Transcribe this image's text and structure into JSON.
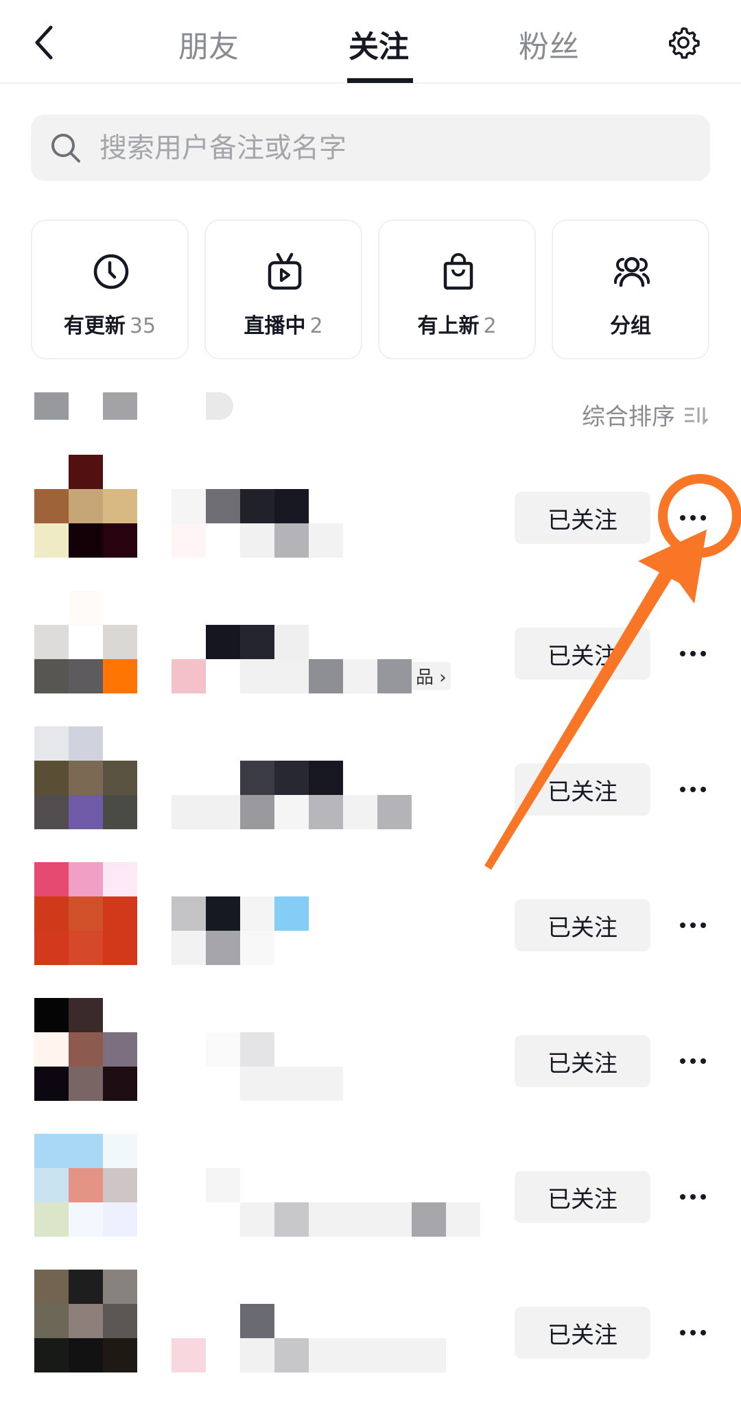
{
  "header": {
    "tabs": [
      {
        "label": "朋友"
      },
      {
        "label": "关注",
        "active": true
      },
      {
        "label": "粉丝"
      }
    ],
    "back_icon": "chevron-left-icon",
    "settings_icon": "gear-icon"
  },
  "search": {
    "placeholder": "搜索用户备注或名字",
    "value": ""
  },
  "quick_filters": [
    {
      "label": "有更新",
      "count": "35",
      "icon": "clock-icon"
    },
    {
      "label": "直播中",
      "count": "2",
      "icon": "tv-play-icon"
    },
    {
      "label": "有上新",
      "count": "2",
      "icon": "shopping-bag-icon"
    },
    {
      "label": "分组",
      "count": "",
      "icon": "group-icon"
    }
  ],
  "sort": {
    "label": "综合排序",
    "icon": "sort-icon"
  },
  "follow_label": "已关注",
  "rows": [
    {
      "avatar": [
        [
          null,
          "#521010",
          null
        ],
        [
          "#9E6339",
          "#C6A677",
          "#D8B983"
        ],
        [
          "#EFEBC4",
          "#130006",
          "#27020F"
        ]
      ],
      "name": [
        [
          "#F5F5F5",
          "#6E6E74",
          "#20212A",
          "#161720"
        ],
        [
          "#FFF5F6",
          null,
          "#F1F1F1",
          "#B3B3B8",
          "#F2F2F2"
        ]
      ]
    },
    {
      "avatar": [
        [
          null,
          "#FFFBF6",
          null
        ],
        [
          "#DDDCDA",
          "#FFFFFF",
          "#D9D8D4"
        ],
        [
          "#575653",
          "#5E5B5E",
          "#FF7503"
        ]
      ],
      "name": [
        [
          null,
          "#15161F",
          "#24252F",
          "#EFEFEF"
        ],
        [
          "#F4C0C9",
          null,
          "#F1F1F1",
          "#F1F1F1",
          "#8E8F94",
          "#F2F2F2",
          "#96979C"
        ]
      ],
      "tag": "品 ›"
    },
    {
      "avatar": [
        [
          "#E6E7EB",
          "#D0D2DE",
          null
        ],
        [
          "#5A4F34",
          "#7B6953",
          "#5A5342"
        ],
        [
          "#514C4D",
          "#6E5AA6",
          "#4A4B45"
        ]
      ],
      "name": [
        [
          null,
          null,
          "#3A3B45",
          "#272831",
          "#161720"
        ],
        [
          "#F1F1F1",
          "#F1F1F1",
          "#9A9A9E",
          "#F5F5F5",
          "#B7B7BB",
          "#F2F2F2",
          "#B4B4B8"
        ]
      ]
    },
    {
      "avatar": [
        [
          "#E64A70",
          "#F0A0C4",
          "#FDE8F5"
        ],
        [
          "#CF3A1A",
          "#D0502A",
          "#D2391B"
        ],
        [
          "#D33A1D",
          "#D5492A",
          "#D2391B"
        ]
      ],
      "name": [
        [
          "#C3C3C5",
          "#171922",
          "#F4F4F4",
          "#86CDF5"
        ],
        [
          "#F2F2F2",
          "#A6A6AA",
          "#F8F8F8"
        ]
      ]
    },
    {
      "avatar": [
        [
          "#050505",
          "#3A2A2A",
          null
        ],
        [
          "#FFF5EE",
          "#8C5A4E",
          "#7C7080"
        ],
        [
          "#0C0710",
          "#7A6565",
          "#1F0D14"
        ]
      ],
      "name": [
        [
          null,
          "#FAFAFA",
          "#E4E4E6"
        ],
        [
          null,
          null,
          "#F2F2F2",
          "#F2F2F2",
          "#F2F2F2"
        ]
      ]
    },
    {
      "avatar": [
        [
          "#A8D8F5",
          "#A8D8F5",
          "#F2F7FB"
        ],
        [
          "#C9E3F1",
          "#E59384",
          "#CFC4C6"
        ],
        [
          "#DBE5C8",
          "#F5F7FF",
          "#EEF0FD"
        ]
      ],
      "name": [
        [
          null,
          "#F5F5F5"
        ],
        [
          null,
          null,
          "#F2F2F2",
          "#C8C8CA",
          "#F2F2F2",
          "#F2F2F2",
          "#F2F2F2",
          "#A7A7AB",
          "#F2F2F2"
        ]
      ]
    },
    {
      "avatar": [
        [
          "#736451",
          "#1E1E1E",
          "#87827E"
        ],
        [
          "#6C6757",
          "#8D7F7A",
          "#5A5755"
        ],
        [
          "#181A17",
          "#121212",
          "#1E1913"
        ]
      ],
      "name": [
        [
          null,
          null,
          "#696A72"
        ],
        [
          "#F8D7DF",
          null,
          "#F1F1F1",
          "#C7C7C9",
          "#F2F2F2",
          "#F2F2F2",
          "#F2F2F2",
          "#F2F2F2"
        ]
      ]
    }
  ],
  "annotation": {
    "color": "#F97626"
  },
  "colors": {
    "text": "#161823",
    "secondary": "#8a8b91",
    "button_bg": "#f2f2f3"
  }
}
